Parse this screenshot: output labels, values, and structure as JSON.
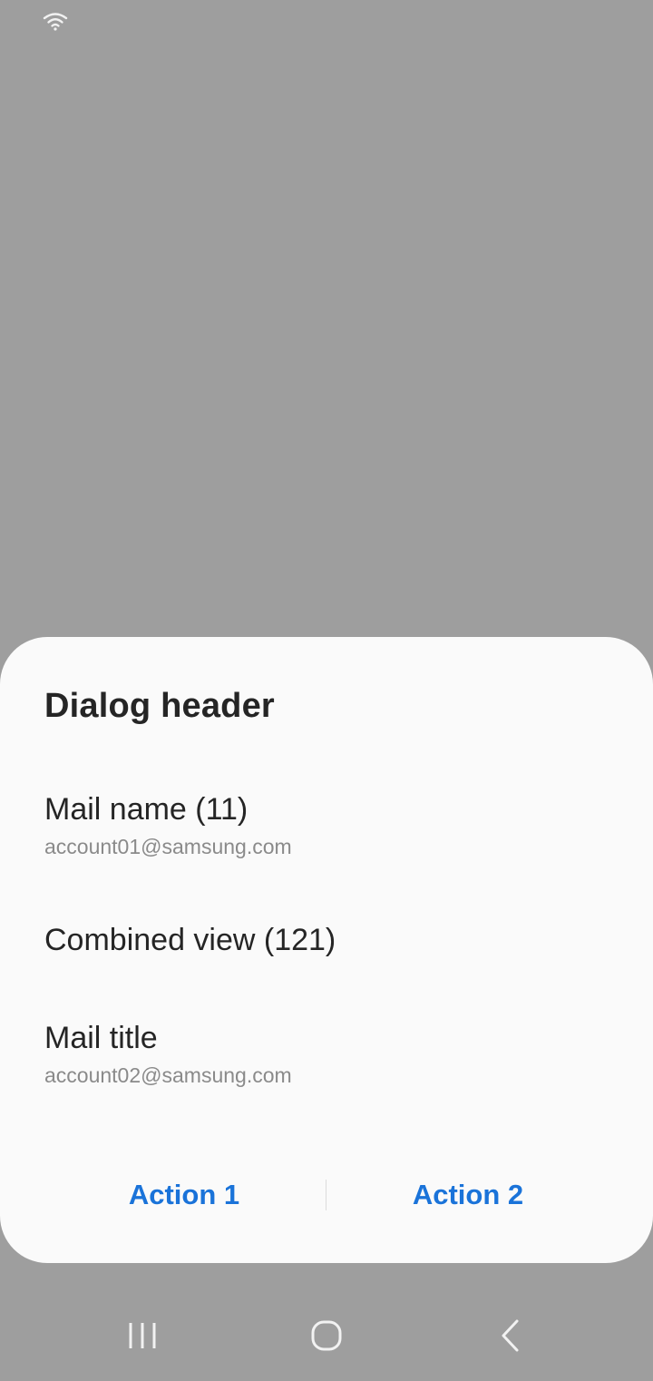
{
  "status_bar": {
    "wifi_icon": "wifi-icon"
  },
  "dialog": {
    "header": "Dialog header",
    "items": [
      {
        "title": "Mail name (11)",
        "subtitle": "account01@samsung.com"
      },
      {
        "title": "Combined view (121)",
        "subtitle": ""
      },
      {
        "title": "Mail title",
        "subtitle": "account02@samsung.com"
      }
    ],
    "actions": {
      "action_1": "Action 1",
      "action_2": "Action 2"
    },
    "accent_color": "#1a73d9"
  },
  "nav_bar": {
    "recents_icon": "recents-icon",
    "home_icon": "home-icon",
    "back_icon": "back-icon"
  }
}
